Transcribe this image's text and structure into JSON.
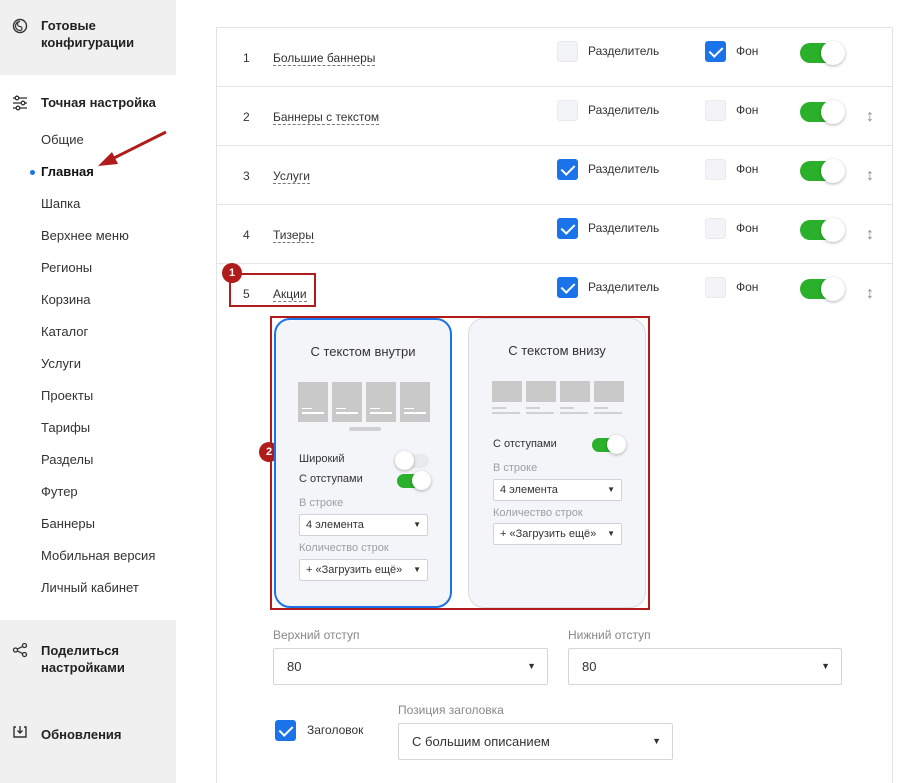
{
  "sidebar": {
    "ready_configs": "Готовые конфигурации",
    "fine_tuning": "Точная настройка",
    "items": [
      {
        "label": "Общие"
      },
      {
        "label": "Главная"
      },
      {
        "label": "Шапка"
      },
      {
        "label": "Верхнее меню"
      },
      {
        "label": "Регионы"
      },
      {
        "label": "Корзина"
      },
      {
        "label": "Каталог"
      },
      {
        "label": "Услуги"
      },
      {
        "label": "Проекты"
      },
      {
        "label": "Тарифы"
      },
      {
        "label": "Разделы"
      },
      {
        "label": "Футер"
      },
      {
        "label": "Баннеры"
      },
      {
        "label": "Мобильная версия"
      },
      {
        "label": "Личный кабинет"
      }
    ],
    "active_item": "Главная",
    "share": "Поделиться настройками",
    "updates": "Обновления"
  },
  "blocks": [
    {
      "num": "1",
      "name": "Большие баннеры",
      "divider_label": "Разделитель",
      "divider_checked": false,
      "bg_label": "Фон",
      "bg_checked": true,
      "enabled": true,
      "draggable": false
    },
    {
      "num": "2",
      "name": "Баннеры с текстом",
      "divider_label": "Разделитель",
      "divider_checked": false,
      "bg_label": "Фон",
      "bg_checked": false,
      "enabled": true,
      "draggable": true
    },
    {
      "num": "3",
      "name": "Услуги",
      "divider_label": "Разделитель",
      "divider_checked": true,
      "bg_label": "Фон",
      "bg_checked": false,
      "enabled": true,
      "draggable": true
    },
    {
      "num": "4",
      "name": "Тизеры",
      "divider_label": "Разделитель",
      "divider_checked": true,
      "bg_label": "Фон",
      "bg_checked": false,
      "enabled": true,
      "draggable": true
    },
    {
      "num": "5",
      "name": "Акции",
      "divider_label": "Разделитель",
      "divider_checked": true,
      "bg_label": "Фон",
      "bg_checked": false,
      "enabled": true,
      "draggable": true
    }
  ],
  "callouts": {
    "one": "1",
    "two": "2"
  },
  "layouts": {
    "inside": {
      "title": "С текстом внутри",
      "selected": true,
      "wide_label": "Широкий",
      "wide_on": false,
      "padding_label": "С отступами",
      "padding_on": true,
      "per_row_label": "В строке",
      "per_row_value": "4 элемента",
      "rows_label": "Количество строк",
      "rows_value": "+ «Загрузить ещё»"
    },
    "below": {
      "title": "С текстом внизу",
      "selected": false,
      "padding_label": "С отступами",
      "padding_on": true,
      "per_row_label": "В строке",
      "per_row_value": "4 элемента",
      "rows_label": "Количество строк",
      "rows_value": "+ «Загрузить ещё»"
    }
  },
  "form": {
    "top_offset_label": "Верхний отступ",
    "top_offset_value": "80",
    "bottom_offset_label": "Нижний отступ",
    "bottom_offset_value": "80",
    "heading_label": "Заголовок",
    "heading_checked": true,
    "heading_position_label": "Позиция заголовка",
    "heading_position_value": "С большим описанием"
  },
  "colors": {
    "accent": "#1a73e8",
    "toggle_on": "#2ab02a",
    "callout": "#b01c1c",
    "sidebar_bg": "#f0f0f0"
  },
  "icons": {
    "ready_configs": "palette-icon",
    "fine_tuning": "sliders-icon",
    "share": "share-icon",
    "updates": "refresh-icon",
    "drag": "drag-handle-icon",
    "dropdown": "caret-down-icon"
  }
}
